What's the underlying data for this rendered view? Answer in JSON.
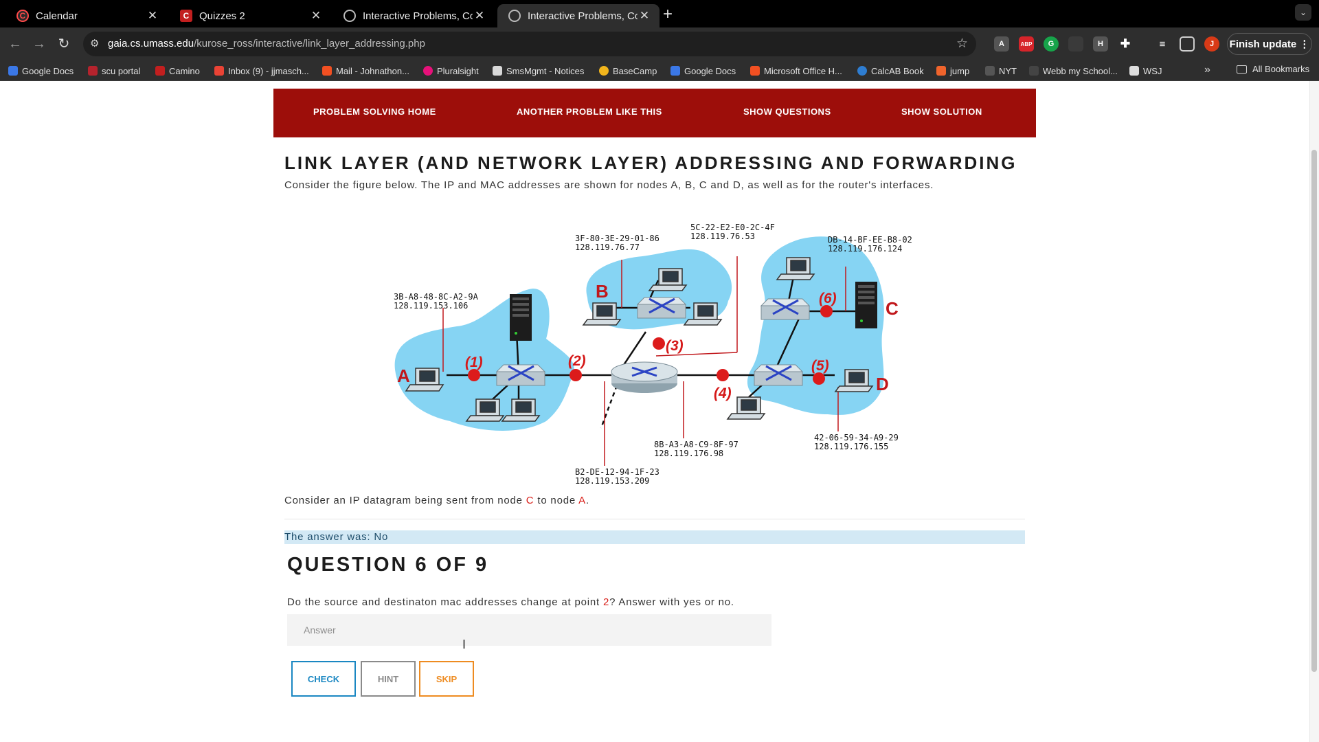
{
  "browser": {
    "tabs": [
      {
        "title": "Calendar",
        "favicon": "camino-icon",
        "active": false
      },
      {
        "title": "Quizzes 2",
        "favicon": "camino-icon",
        "active": false
      },
      {
        "title": "Interactive Problems, Compu",
        "favicon": "globe-icon",
        "active": false
      },
      {
        "title": "Interactive Problems, Compu",
        "favicon": "globe-icon",
        "active": true
      }
    ],
    "url_host": "gaia.cs.umass.edu",
    "url_path": "/kurose_ross/interactive/link_layer_addressing.php",
    "finish_update": "Finish update",
    "bookmarks": [
      "Google Docs",
      "scu portal",
      "Camino",
      "Inbox (9) - jjmasch...",
      "Mail - Johnathon...",
      "Pluralsight",
      "SmsMgmt - Notices",
      "BaseCamp",
      "Google Docs",
      "Microsoft Office H...",
      "CalcAB Book",
      "jump",
      "NYT",
      "Webb my School...",
      "WSJ"
    ],
    "all_bookmarks": "All Bookmarks"
  },
  "nav": {
    "home": "PROBLEM SOLVING HOME",
    "another": "ANOTHER PROBLEM LIKE THIS",
    "questions": "SHOW QUESTIONS",
    "solution": "SHOW SOLUTION"
  },
  "content": {
    "title": "LINK LAYER (AND NETWORK LAYER) ADDRESSING AND FORWARDING",
    "intro": "Consider the figure below. The IP and MAC addresses are shown for nodes A, B, C and D, as well as for the router's interfaces.",
    "consider_prefix": "Consider an IP datagram being sent from node ",
    "consider_src": "C",
    "consider_mid": " to node ",
    "consider_dst": "A",
    "consider_end": ".",
    "answer_was": "The answer was: No",
    "question_heading": "QUESTION 6 OF 9",
    "question_prefix": "Do the source and destinaton mac addresses change at point ",
    "question_point": "2",
    "question_suffix": "? Answer with yes or no.",
    "answer_placeholder": "Answer",
    "check": "CHECK",
    "hint": "HINT",
    "skip": "SKIP"
  },
  "diagram": {
    "nodes": {
      "A": "A",
      "B": "B",
      "C": "C",
      "D": "D"
    },
    "points": [
      "(1)",
      "(2)",
      "(3)",
      "(4)",
      "(5)",
      "(6)"
    ],
    "addresses": {
      "A_mac": "3B-A8-48-8C-A2-9A",
      "A_ip": "128.119.153.106",
      "B_mac": "3F-80-3E-29-01-86",
      "B_ip": "128.119.76.77",
      "R3_mac": "5C-22-E2-E0-2C-4F",
      "R3_ip": "128.119.76.53",
      "C_mac": "DB-14-BF-EE-B8-02",
      "C_ip": "128.119.176.124",
      "R2_mac": "B2-DE-12-94-1F-23",
      "R2_ip": "128.119.153.209",
      "R4_mac": "8B-A3-A8-C9-8F-97",
      "R4_ip": "128.119.176.98",
      "D_mac": "42-06-59-34-A9-29",
      "D_ip": "128.119.176.155"
    },
    "colors": {
      "cloud": "#86d4f3",
      "point": "#dc1b1b",
      "label": "#c0171b"
    }
  }
}
